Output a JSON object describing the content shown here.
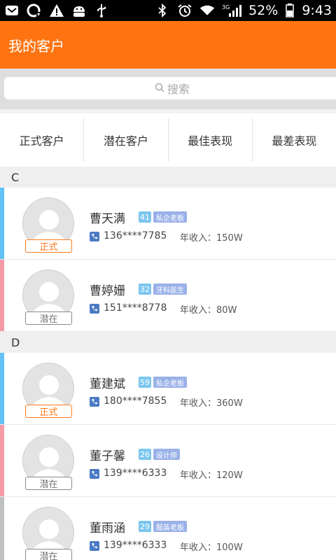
{
  "statusbar": {
    "battery": "52%",
    "time": "9:43",
    "network": "3G"
  },
  "appbar": {
    "title": "我的客户"
  },
  "search": {
    "placeholder": "搜索"
  },
  "tabs": [
    "正式客户",
    "潜在客户",
    "最佳表现",
    "最差表现"
  ],
  "colors": {
    "accent": "#ff7410",
    "edge_blue": "#62c1f6",
    "edge_pink": "#f59aa7",
    "edge_gray": "#c0c0c0"
  },
  "sections": [
    {
      "letter": "C",
      "customers": [
        {
          "name": "曹天满",
          "age": "41",
          "job": "私企老板",
          "phone": "136****7785",
          "income_label": "年收入：",
          "income": "150W",
          "status": "正式",
          "edge": "blue"
        },
        {
          "name": "曹婷姗",
          "age": "32",
          "job": "牙科医生",
          "phone": "151****8778",
          "income_label": "年收入：",
          "income": "80W",
          "status": "潜在",
          "edge": "pink"
        }
      ]
    },
    {
      "letter": "D",
      "customers": [
        {
          "name": "董建斌",
          "age": "59",
          "job": "私企老板",
          "phone": "180****7855",
          "income_label": "年收入：",
          "income": "360W",
          "status": "正式",
          "edge": "blue"
        },
        {
          "name": "董子馨",
          "age": "26",
          "job": "设计师",
          "phone": "139****6333",
          "income_label": "年收入：",
          "income": "120W",
          "status": "潜在",
          "edge": "pink"
        },
        {
          "name": "董雨涵",
          "age": "29",
          "job": "服装老板",
          "phone": "139****6333",
          "income_label": "年收入：",
          "income": "100W",
          "status": "潜在",
          "edge": "gray"
        }
      ]
    }
  ]
}
